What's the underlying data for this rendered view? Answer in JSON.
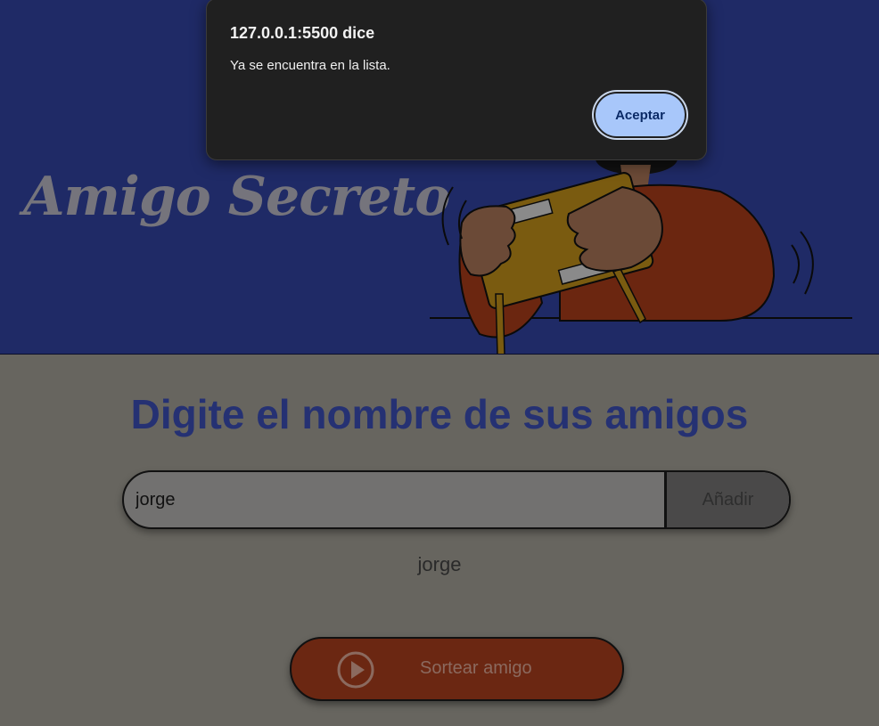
{
  "header": {
    "title": "Amigo Secreto",
    "illustration": "person-shaking-box-illustration"
  },
  "main": {
    "heading": "Digite el nombre de sus amigos",
    "input": {
      "value": "jorge"
    },
    "add_button_label": "Añadir",
    "friends": [
      "jorge"
    ],
    "draw_button": {
      "label": "Sortear amigo",
      "icon": "play-circle-icon"
    }
  },
  "dialog": {
    "title": "127.0.0.1:5500 dice",
    "message": "Ya se encuentra en la lista.",
    "ok_label": "Aceptar"
  },
  "colors": {
    "header_bg": "#1f2a66",
    "heading": "#253173",
    "draw_button": "#6b2712",
    "dialog_bg": "#202020",
    "dialog_button": "#a8c7fa"
  }
}
